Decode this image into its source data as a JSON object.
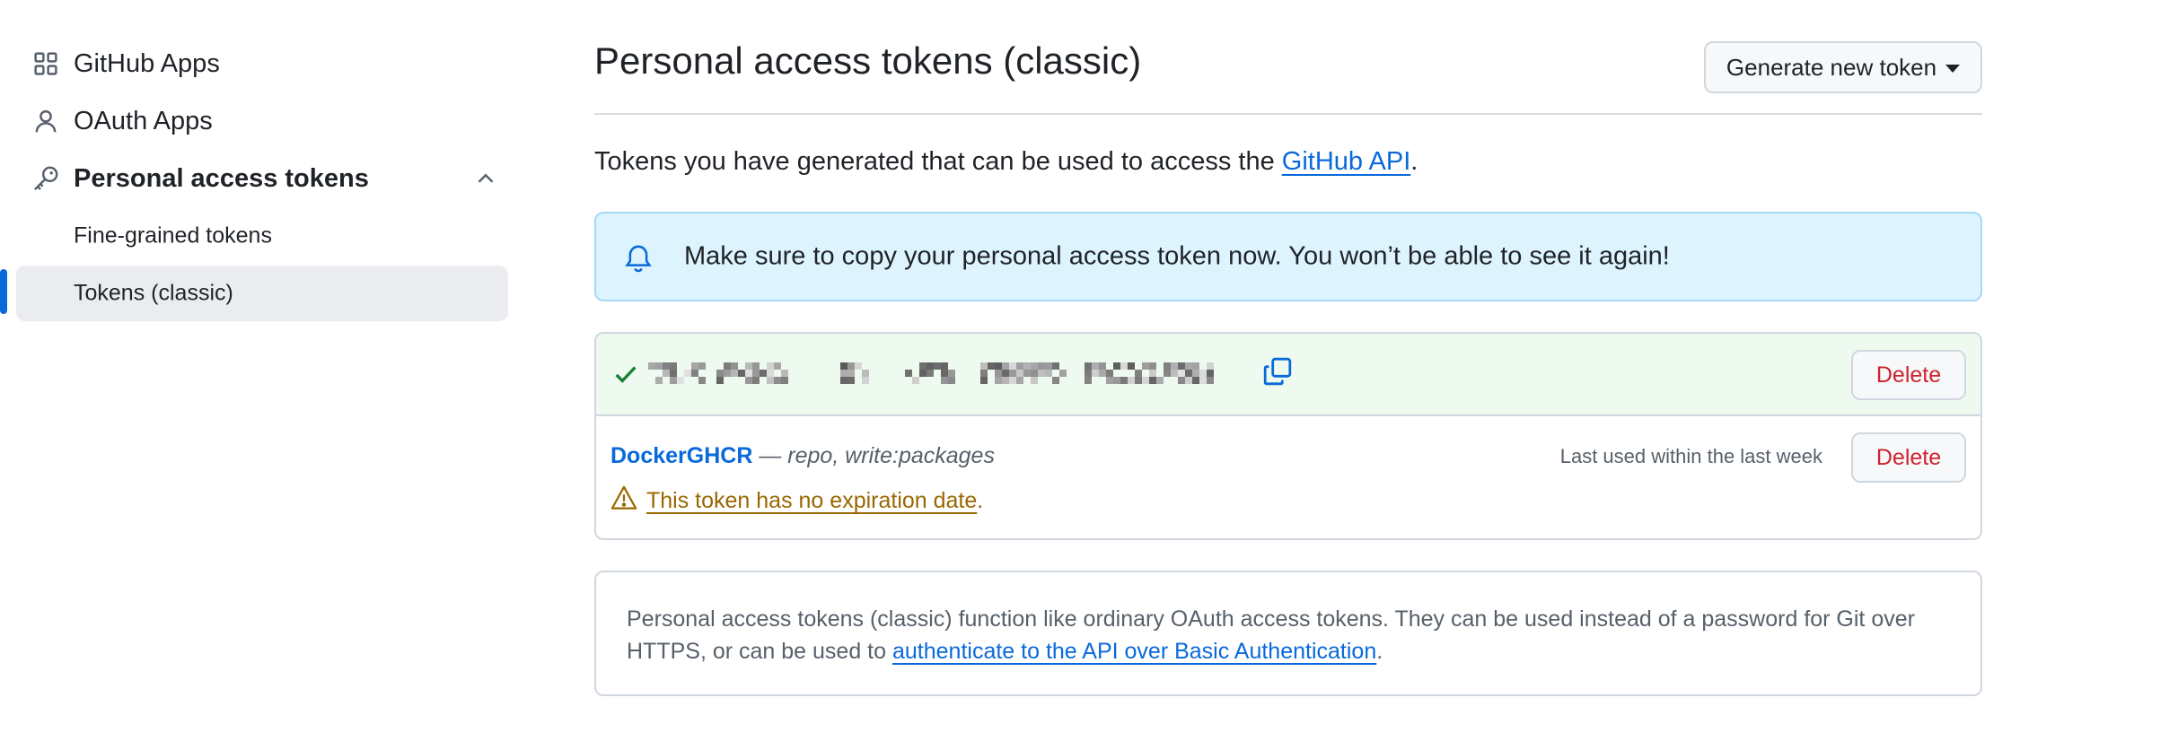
{
  "sidebar": {
    "items": [
      {
        "label": "GitHub Apps",
        "icon": "apps-grid-icon"
      },
      {
        "label": "OAuth Apps",
        "icon": "person-icon"
      },
      {
        "label": "Personal access tokens",
        "icon": "key-icon",
        "expanded": true
      },
      {
        "label": "Fine-grained tokens"
      },
      {
        "label": "Tokens (classic)",
        "active": true
      }
    ]
  },
  "header": {
    "title": "Personal access tokens (classic)",
    "generate_button": "Generate new token"
  },
  "intro": {
    "before": "Tokens you have generated that can be used to access the ",
    "link": "GitHub API",
    "after": "."
  },
  "flash": {
    "message": "Make sure to copy your personal access token now. You won’t be able to see it again!"
  },
  "new_token": {
    "delete_label": "Delete"
  },
  "tokens": [
    {
      "name": "DockerGHCR",
      "separator": " — ",
      "scopes": "repo, write:packages",
      "last_used": "Last used within the last week",
      "delete_label": "Delete",
      "warning": "This token has no expiration date",
      "warning_end": "."
    }
  ],
  "note": {
    "text": "Personal access tokens (classic) function like ordinary OAuth access tokens. They can be used instead of a password for Git over HTTPS, or can be used to ",
    "link": "authenticate to the API over Basic Authentication",
    "end": "."
  },
  "colors": {
    "accent": "#0969da",
    "danger": "#cf222e",
    "attention": "#9a6700",
    "success": "#1a7f37",
    "flash_bg": "#ddf4ff",
    "new_token_bg": "#eefaf0"
  }
}
